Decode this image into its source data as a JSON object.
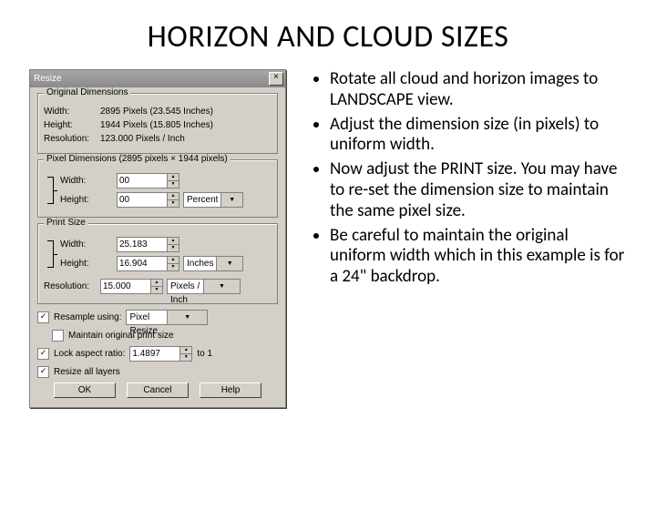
{
  "title": "HORIZON AND CLOUD SIZES",
  "dialog": {
    "title": "Resize",
    "groups": {
      "original": {
        "legend": "Original Dimensions",
        "width_label": "Width:",
        "width_value": "2895 Pixels (23.545 Inches)",
        "height_label": "Height:",
        "height_value": "1944 Pixels (15.805 Inches)",
        "resolution_label": "Resolution:",
        "resolution_value": "123.000 Pixels / Inch"
      },
      "pixel": {
        "legend": "Pixel Dimensions (2895 pixels × 1944 pixels)",
        "width_label": "Width:",
        "width_value": "00",
        "height_label": "Height:",
        "height_value": "00",
        "unit": "Percent"
      },
      "print": {
        "legend": "Print Size",
        "width_label": "Width:",
        "width_value": "25.183",
        "height_label": "Height:",
        "height_value": "16.904",
        "unit": "Inches",
        "resolution_label": "Resolution:",
        "resolution_value": "15.000",
        "resolution_unit": "Pixels / Inch"
      }
    },
    "opts": {
      "resample_label": "Resample using:",
      "resample_value": "Pixel Resize",
      "maintain_label": "Maintain original print size",
      "lock_label": "Lock aspect ratio:",
      "lock_value": "1.4897",
      "lock_unit": "to 1",
      "resize_layers_label": "Resize all layers"
    },
    "buttons": {
      "ok": "OK",
      "cancel": "Cancel",
      "help": "Help"
    }
  },
  "bullets": [
    "Rotate all cloud and horizon images to LANDSCAPE view.",
    "Adjust the dimension size (in pixels) to uniform width.",
    "Now adjust the PRINT size.  You may have to re-set the dimension size to maintain the same pixel size.",
    "Be  careful to maintain the original uniform width which in this example is for a 24\" backdrop."
  ]
}
